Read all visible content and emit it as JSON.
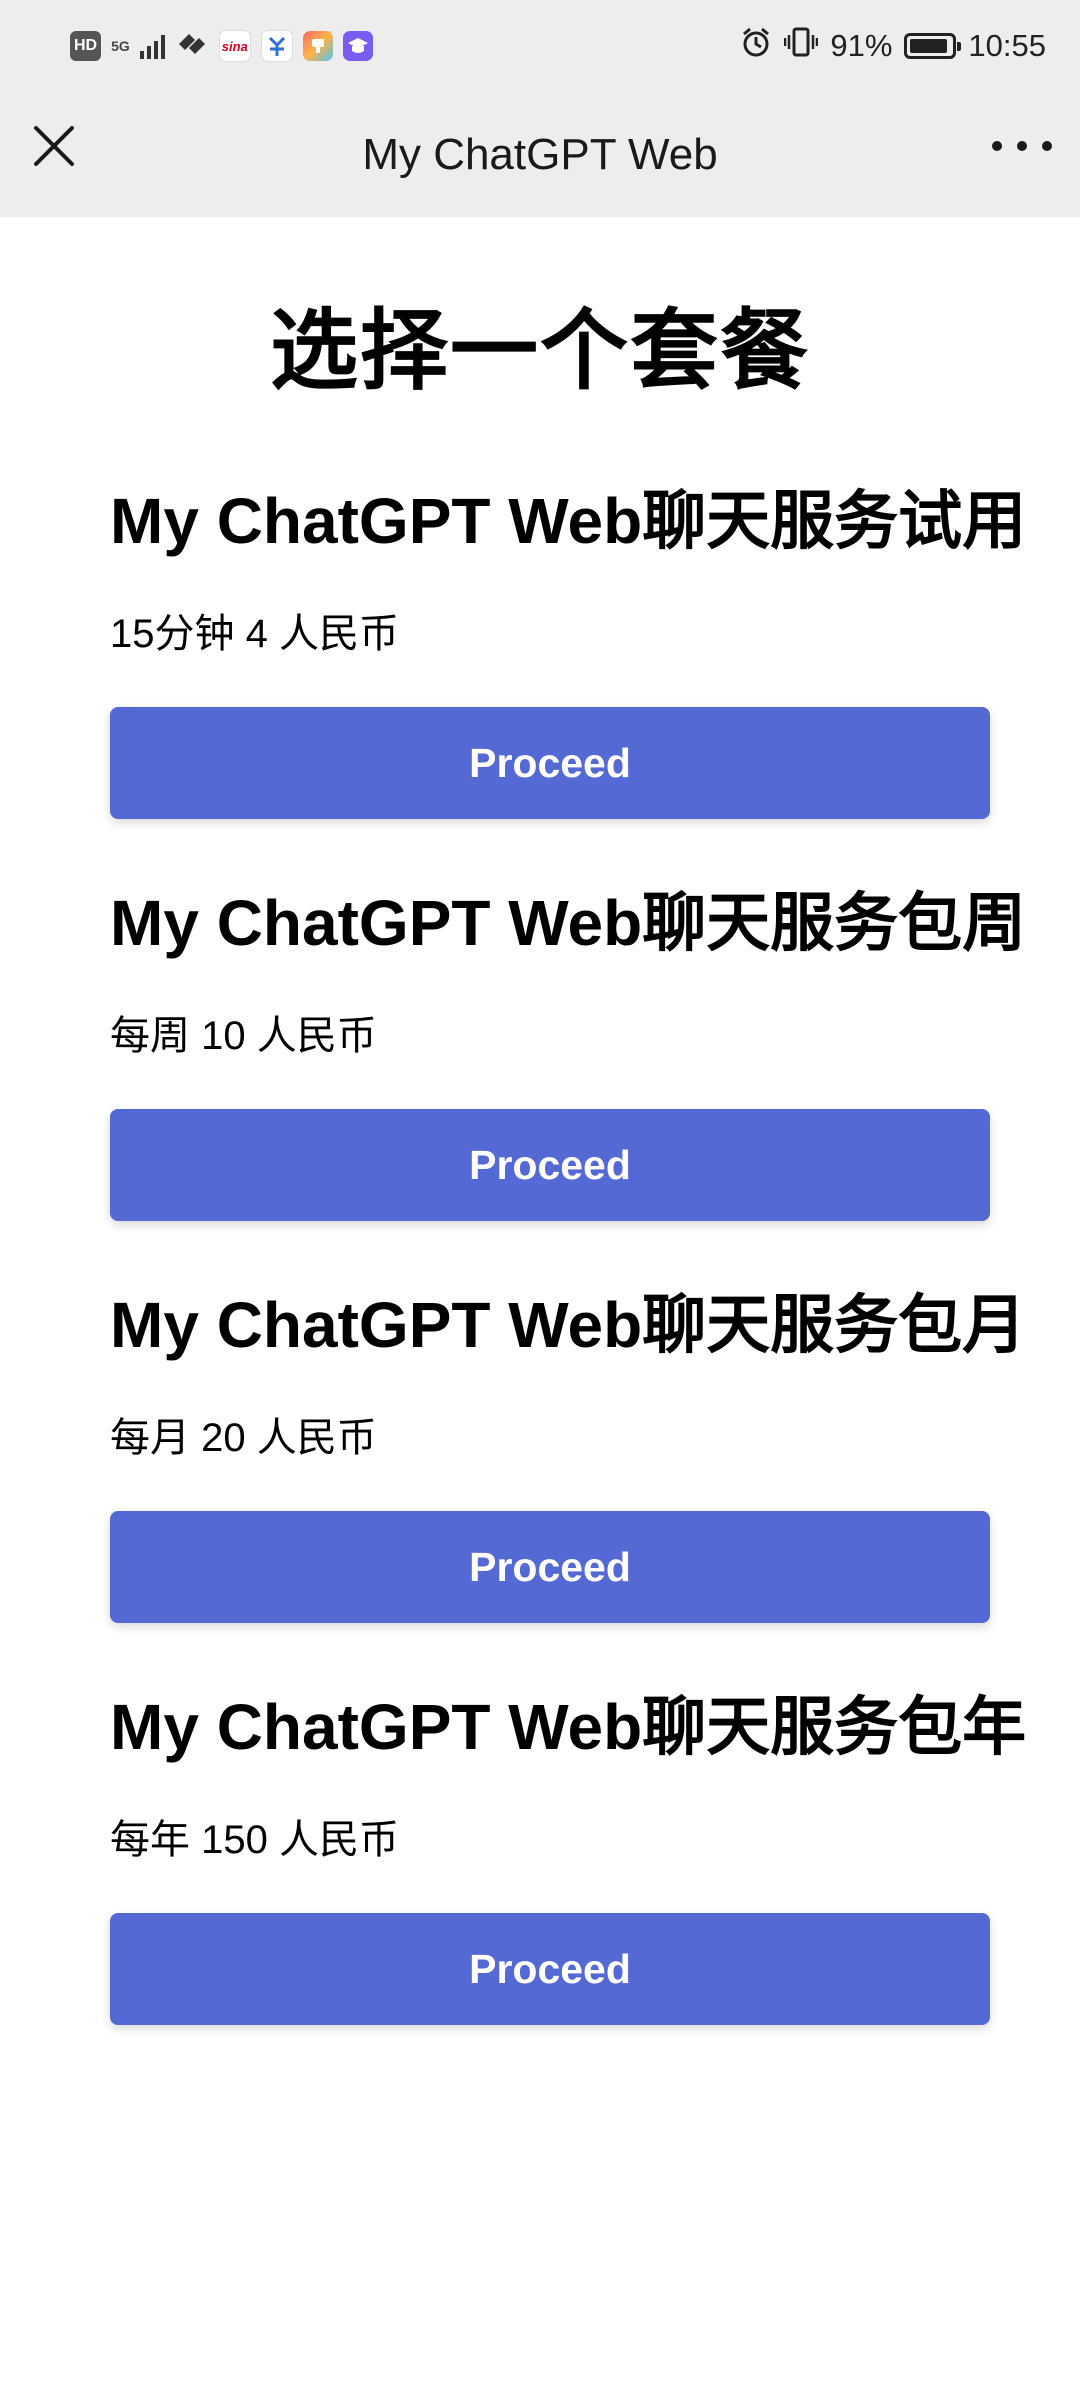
{
  "status_bar": {
    "hd_badge": "HD",
    "network_type": "5G",
    "sina_badge": "sina",
    "battery_percent": "91%",
    "battery_level": 0.91,
    "time": "10:55"
  },
  "nav": {
    "title": "My ChatGPT Web"
  },
  "page": {
    "heading": "选择一个套餐"
  },
  "plans": [
    {
      "title": "My ChatGPT Web聊天服务试用",
      "price": "15分钟 4 人民币",
      "button": "Proceed"
    },
    {
      "title": "My ChatGPT Web聊天服务包周",
      "price": "每周 10 人民币",
      "button": "Proceed"
    },
    {
      "title": "My ChatGPT Web聊天服务包月",
      "price": "每月 20 人民币",
      "button": "Proceed"
    },
    {
      "title": "My ChatGPT Web聊天服务包年",
      "price": "每年 150 人民币",
      "button": "Proceed"
    }
  ],
  "colors": {
    "accent": "#5469d4",
    "header_bg": "#ededed"
  }
}
